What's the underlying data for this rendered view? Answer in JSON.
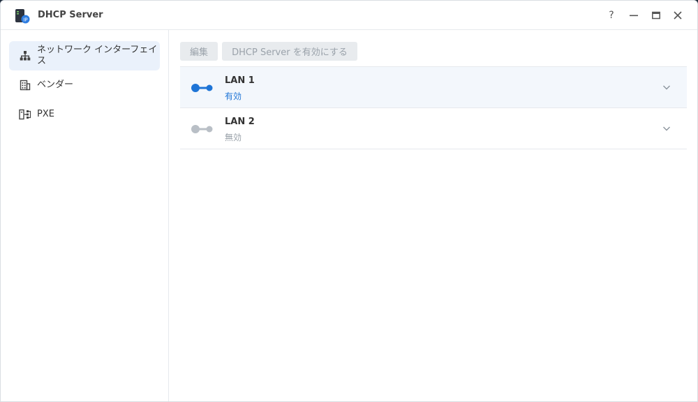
{
  "window": {
    "title": "DHCP Server",
    "controls": {
      "help": "?",
      "minimize": "—",
      "maximize": "▭",
      "close": "✕"
    }
  },
  "sidebar": {
    "items": [
      {
        "label": "ネットワーク インターフェイス",
        "icon": "network-tree-icon",
        "active": true
      },
      {
        "label": "ベンダー",
        "icon": "building-icon",
        "active": false
      },
      {
        "label": "PXE",
        "icon": "pxe-icon",
        "active": false
      }
    ]
  },
  "toolbar": {
    "edit_label": "編集",
    "enable_label": "DHCP Server を有効にする"
  },
  "interfaces": [
    {
      "name": "LAN 1",
      "status": "有効",
      "enabled": true
    },
    {
      "name": "LAN 2",
      "status": "無効",
      "enabled": false
    }
  ],
  "colors": {
    "accent": "#1e74d6",
    "disabled": "#9aa2aa",
    "selected_bg": "#eaf1fb"
  }
}
